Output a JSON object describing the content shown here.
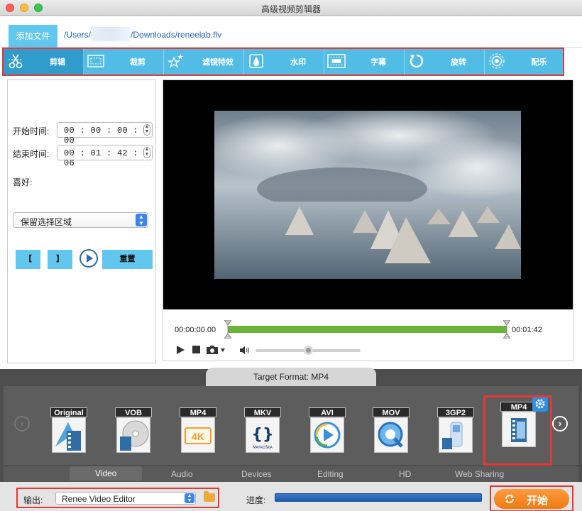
{
  "window": {
    "title": "高级视频剪辑器"
  },
  "file": {
    "add_label": "添加文件",
    "path_prefix": "/Users/",
    "path_suffix": "/Downloads/reneelab.flv"
  },
  "tools": [
    {
      "label": "剪辑",
      "icon": "scissors-icon"
    },
    {
      "label": "裁剪",
      "icon": "crop-icon"
    },
    {
      "label": "滤镜特效",
      "icon": "magic-stars-icon"
    },
    {
      "label": "水印",
      "icon": "watermark-drop-icon"
    },
    {
      "label": "字幕",
      "icon": "subtitle-icon"
    },
    {
      "label": "旋转",
      "icon": "rotate-icon"
    },
    {
      "label": "配乐",
      "icon": "music-icon"
    }
  ],
  "trim": {
    "start_label": "开始时间:",
    "start_value": "00 : 00 : 00 : 00",
    "end_label": "结束时间:",
    "end_value": "00 : 01 : 42 : 06",
    "pref_label": "喜好:",
    "pref_value": "保留选择区域",
    "bracket_open": "【",
    "bracket_close": "】",
    "reset_label": "重置"
  },
  "player": {
    "time_start": "00:00:00.00",
    "time_end": "00:01:42",
    "volume": 0.5
  },
  "format": {
    "header": "Target Format: MP4",
    "items": [
      {
        "tag": "Original",
        "extra": ""
      },
      {
        "tag": "VOB",
        "extra": ""
      },
      {
        "tag": "MP4",
        "extra": "4K"
      },
      {
        "tag": "MKV",
        "extra": "MATROŠKA"
      },
      {
        "tag": "AVI",
        "extra": ""
      },
      {
        "tag": "MOV",
        "extra": ""
      },
      {
        "tag": "3GP2",
        "extra": ""
      },
      {
        "tag": "MP4",
        "extra": ""
      }
    ],
    "selected": "MP4",
    "categories": [
      "Video",
      "Audio",
      "Devices",
      "Editing",
      "HD",
      "Web Sharing"
    ]
  },
  "output": {
    "label": "输出:",
    "value": "Renee Video Editor",
    "progress_label": "进度:",
    "start_label": "开始"
  },
  "colors": {
    "accent": "#51bde6",
    "active_tool": "#2f9ccc",
    "highlight": "#e53935",
    "start": "#f07a12",
    "progress": "#1f5aa8"
  }
}
